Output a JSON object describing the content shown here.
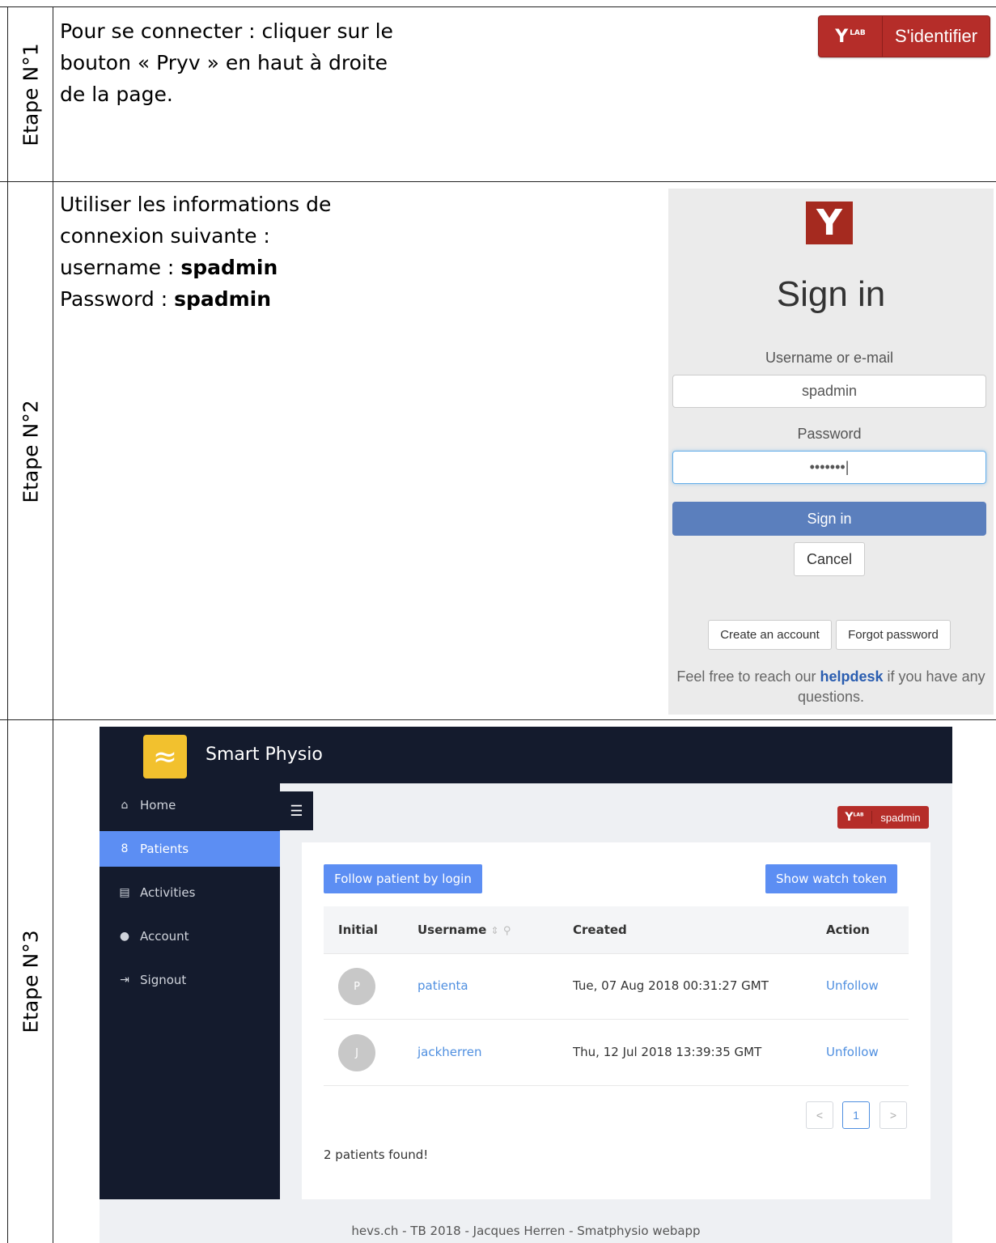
{
  "steps": [
    {
      "label": "Etape N°1",
      "text_lines": [
        "Pour se connecter : cliquer sur le",
        "bouton « Pryv » en haut à droite",
        "de la page."
      ]
    },
    {
      "label": "Etape N°2",
      "text_lines": [
        "Utiliser les informations de",
        "connexion suivante :"
      ],
      "username_label": "username : ",
      "username_value": "spadmin",
      "password_label": "Password : ",
      "password_value": "spadmin"
    },
    {
      "label": "Etape N°3"
    }
  ],
  "pryv_button": {
    "logo": "Y",
    "logo_sup": "LAB",
    "label": "S'identifier",
    "color": "#b52d29"
  },
  "signin_panel": {
    "logo": "Y",
    "title": "Sign in",
    "username_label": "Username or e-mail",
    "username_value": "spadmin",
    "password_label": "Password",
    "password_value": "•••••••|",
    "signin_button": "Sign in",
    "cancel_button": "Cancel",
    "create_account_button": "Create an account",
    "forgot_password_button": "Forgot password",
    "help_prefix": "Feel free to reach our ",
    "help_link": "helpdesk",
    "help_suffix": " if you have any questions.",
    "primary_color": "#5b7fbd"
  },
  "app": {
    "name": "Smart Physio",
    "logo_glyph": "≈",
    "nav": [
      {
        "label": "Home",
        "icon": "home-icon",
        "glyph": "⌂"
      },
      {
        "label": "Patients",
        "icon": "users-icon",
        "glyph": "8",
        "active": true
      },
      {
        "label": "Activities",
        "icon": "list-icon",
        "glyph": "▤"
      },
      {
        "label": "Account",
        "icon": "info-icon",
        "glyph": "●"
      },
      {
        "label": "Signout",
        "icon": "logout-icon",
        "glyph": "⇥"
      }
    ],
    "menu_toggle_glyph": "☰",
    "user_badge": {
      "logo": "Y",
      "logo_sup": "LAB",
      "username": "spadmin"
    },
    "follow_button": "Follow patient by login",
    "watch_token_button": "Show watch token",
    "table": {
      "headers": [
        "Initial",
        "Username",
        "Created",
        "Action"
      ],
      "rows": [
        {
          "initial": "P",
          "username": "patienta",
          "created": "Tue, 07 Aug 2018 00:31:27 GMT",
          "action": "Unfollow"
        },
        {
          "initial": "J",
          "username": "jackherren",
          "created": "Thu, 12 Jul 2018 13:39:35 GMT",
          "action": "Unfollow"
        }
      ]
    },
    "pagination": {
      "prev": "<",
      "current": "1",
      "next": ">"
    },
    "found_text": "2 patients found!",
    "footer": "hevs.ch - TB 2018 - Jacques Herren - Smatphysio webapp",
    "accent_color": "#5c8ef3",
    "sidebar_color": "#141b2d"
  }
}
